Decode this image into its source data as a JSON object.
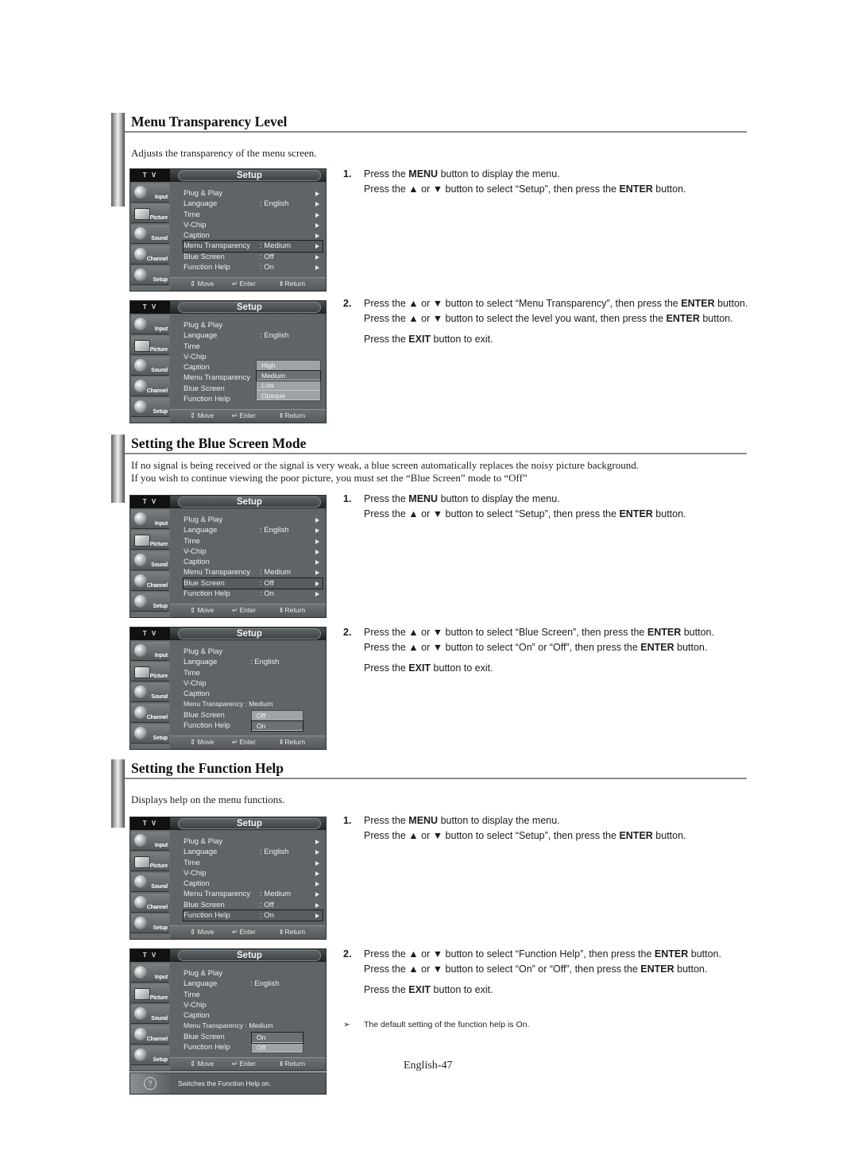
{
  "sections": [
    {
      "title": "Menu Transparency Level",
      "description": [
        "Adjusts the transparency of the menu screen."
      ]
    },
    {
      "title": "Setting the Blue Screen Mode",
      "description": [
        "If no signal is being received or the signal is very weak, a blue screen automatically replaces the noisy picture background.",
        "If you wish to continue viewing the poor picture, you must set the “Blue Screen” mode to “Off”"
      ]
    },
    {
      "title": "Setting the Function Help",
      "description": [
        "Displays help on the menu functions."
      ]
    }
  ],
  "tv_menu": {
    "tv_label": "T V",
    "title": "Setup",
    "side_tabs": [
      "Input",
      "Picture",
      "Sound",
      "Channel",
      "Setup"
    ],
    "items": [
      {
        "name": "Plug & Play",
        "value": ""
      },
      {
        "name": "Language",
        "value": ": English"
      },
      {
        "name": "Time",
        "value": ""
      },
      {
        "name": "V-Chip",
        "value": ""
      },
      {
        "name": "Caption",
        "value": ""
      },
      {
        "name": "Menu Transparency",
        "value": ": Medium"
      },
      {
        "name": "Blue Screen",
        "value": ": Off"
      },
      {
        "name": "Function Help",
        "value": ": On"
      }
    ],
    "footer": {
      "move": "Move",
      "enter": "Enter",
      "return": "Return"
    },
    "transparency_options": [
      "High",
      "Medium",
      "Low",
      "Opaque"
    ],
    "transparency_selected": "Medium",
    "blue_screen_options": [
      "Off",
      "On"
    ],
    "blue_screen_selected": "On",
    "function_help_options": [
      "On",
      "Off"
    ],
    "function_help_selected": "On",
    "menu_transparency_inline": "Menu Transparency : Medium",
    "help_text": "Switches the Function Help on."
  },
  "steps": {
    "s1_1": {
      "num": "1.",
      "l1a": "Press the ",
      "l1b": "MENU",
      "l1c": " button to display the menu.",
      "l2a": "Press the ▲ or ▼ button to select “Setup”, then press the ",
      "l2b": "ENTER",
      "l2c": " button."
    },
    "s1_2": {
      "num": "2.",
      "l1a": "Press the ▲ or ▼ button to select “Menu Transparency”, then press the ",
      "l1b": "ENTER",
      "l1c": " button.",
      "l2a": "Press the ▲ or ▼ button to select the level you want, then press the ",
      "l2b": "ENTER",
      "l2c": " button.",
      "l3a": "Press the ",
      "l3b": "EXIT",
      "l3c": " button to exit."
    },
    "s2_1": {
      "num": "1.",
      "l1a": "Press the ",
      "l1b": "MENU",
      "l1c": " button to display the menu.",
      "l2a": "Press the ▲ or ▼ button to select “Setup”, then press the ",
      "l2b": "ENTER",
      "l2c": " button."
    },
    "s2_2": {
      "num": "2.",
      "l1a": "Press the ▲ or ▼ button to select “Blue Screen”, then press the ",
      "l1b": "ENTER",
      "l1c": " button.",
      "l2a": "Press the ▲ or ▼ button to select “On” or “Off”, then press the ",
      "l2b": "ENTER",
      "l2c": " button.",
      "l3a": "Press the ",
      "l3b": "EXIT",
      "l3c": " button to exit."
    },
    "s3_1": {
      "num": "1.",
      "l1a": "Press the ",
      "l1b": "MENU",
      "l1c": " button to display the menu.",
      "l2a": "Press the ▲ or ▼ button to select “Setup”, then press the ",
      "l2b": "ENTER",
      "l2c": " button."
    },
    "s3_2": {
      "num": "2.",
      "l1a": "Press the ▲ or ▼ button to select “Function Help”, then press the ",
      "l1b": "ENTER",
      "l1c": " button.",
      "l2a": "Press the ▲ or ▼ button to select “On” or “Off”, then press the ",
      "l2b": "ENTER",
      "l2c": " button.",
      "l3a": "Press the ",
      "l3b": "EXIT",
      "l3c": " button to exit."
    }
  },
  "note": {
    "marker": "➢",
    "text": "The default setting of the function help is On."
  },
  "page_number": "English-47"
}
